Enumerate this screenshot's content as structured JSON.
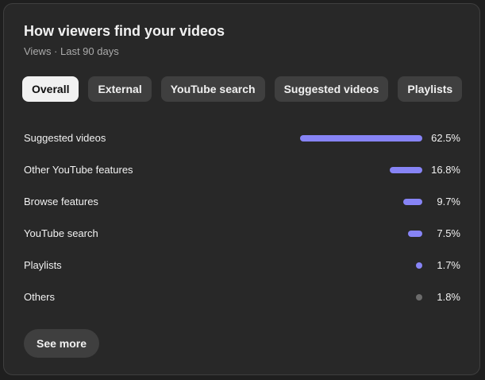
{
  "card": {
    "title": "How viewers find your videos",
    "subtitle": "Views · Last 90 days"
  },
  "tabs": [
    {
      "label": "Overall",
      "active": true
    },
    {
      "label": "External",
      "active": false
    },
    {
      "label": "YouTube search",
      "active": false
    },
    {
      "label": "Suggested videos",
      "active": false
    },
    {
      "label": "Playlists",
      "active": false
    }
  ],
  "sources": [
    {
      "label": "Suggested videos",
      "value": "62.5%",
      "percent": 62.5
    },
    {
      "label": "Other YouTube features",
      "value": "16.8%",
      "percent": 16.8
    },
    {
      "label": "Browse features",
      "value": "9.7%",
      "percent": 9.7
    },
    {
      "label": "YouTube search",
      "value": "7.5%",
      "percent": 7.5
    },
    {
      "label": "Playlists",
      "value": "1.7%",
      "percent": 1.7
    },
    {
      "label": "Others",
      "value": "1.8%",
      "percent": 1.8
    }
  ],
  "colors": {
    "bar": "#8784f6",
    "bar_other": "#6b6b6b",
    "active_chip": "#f1f1f1",
    "chip": "#3f3f3f"
  },
  "see_more_label": "See more"
}
